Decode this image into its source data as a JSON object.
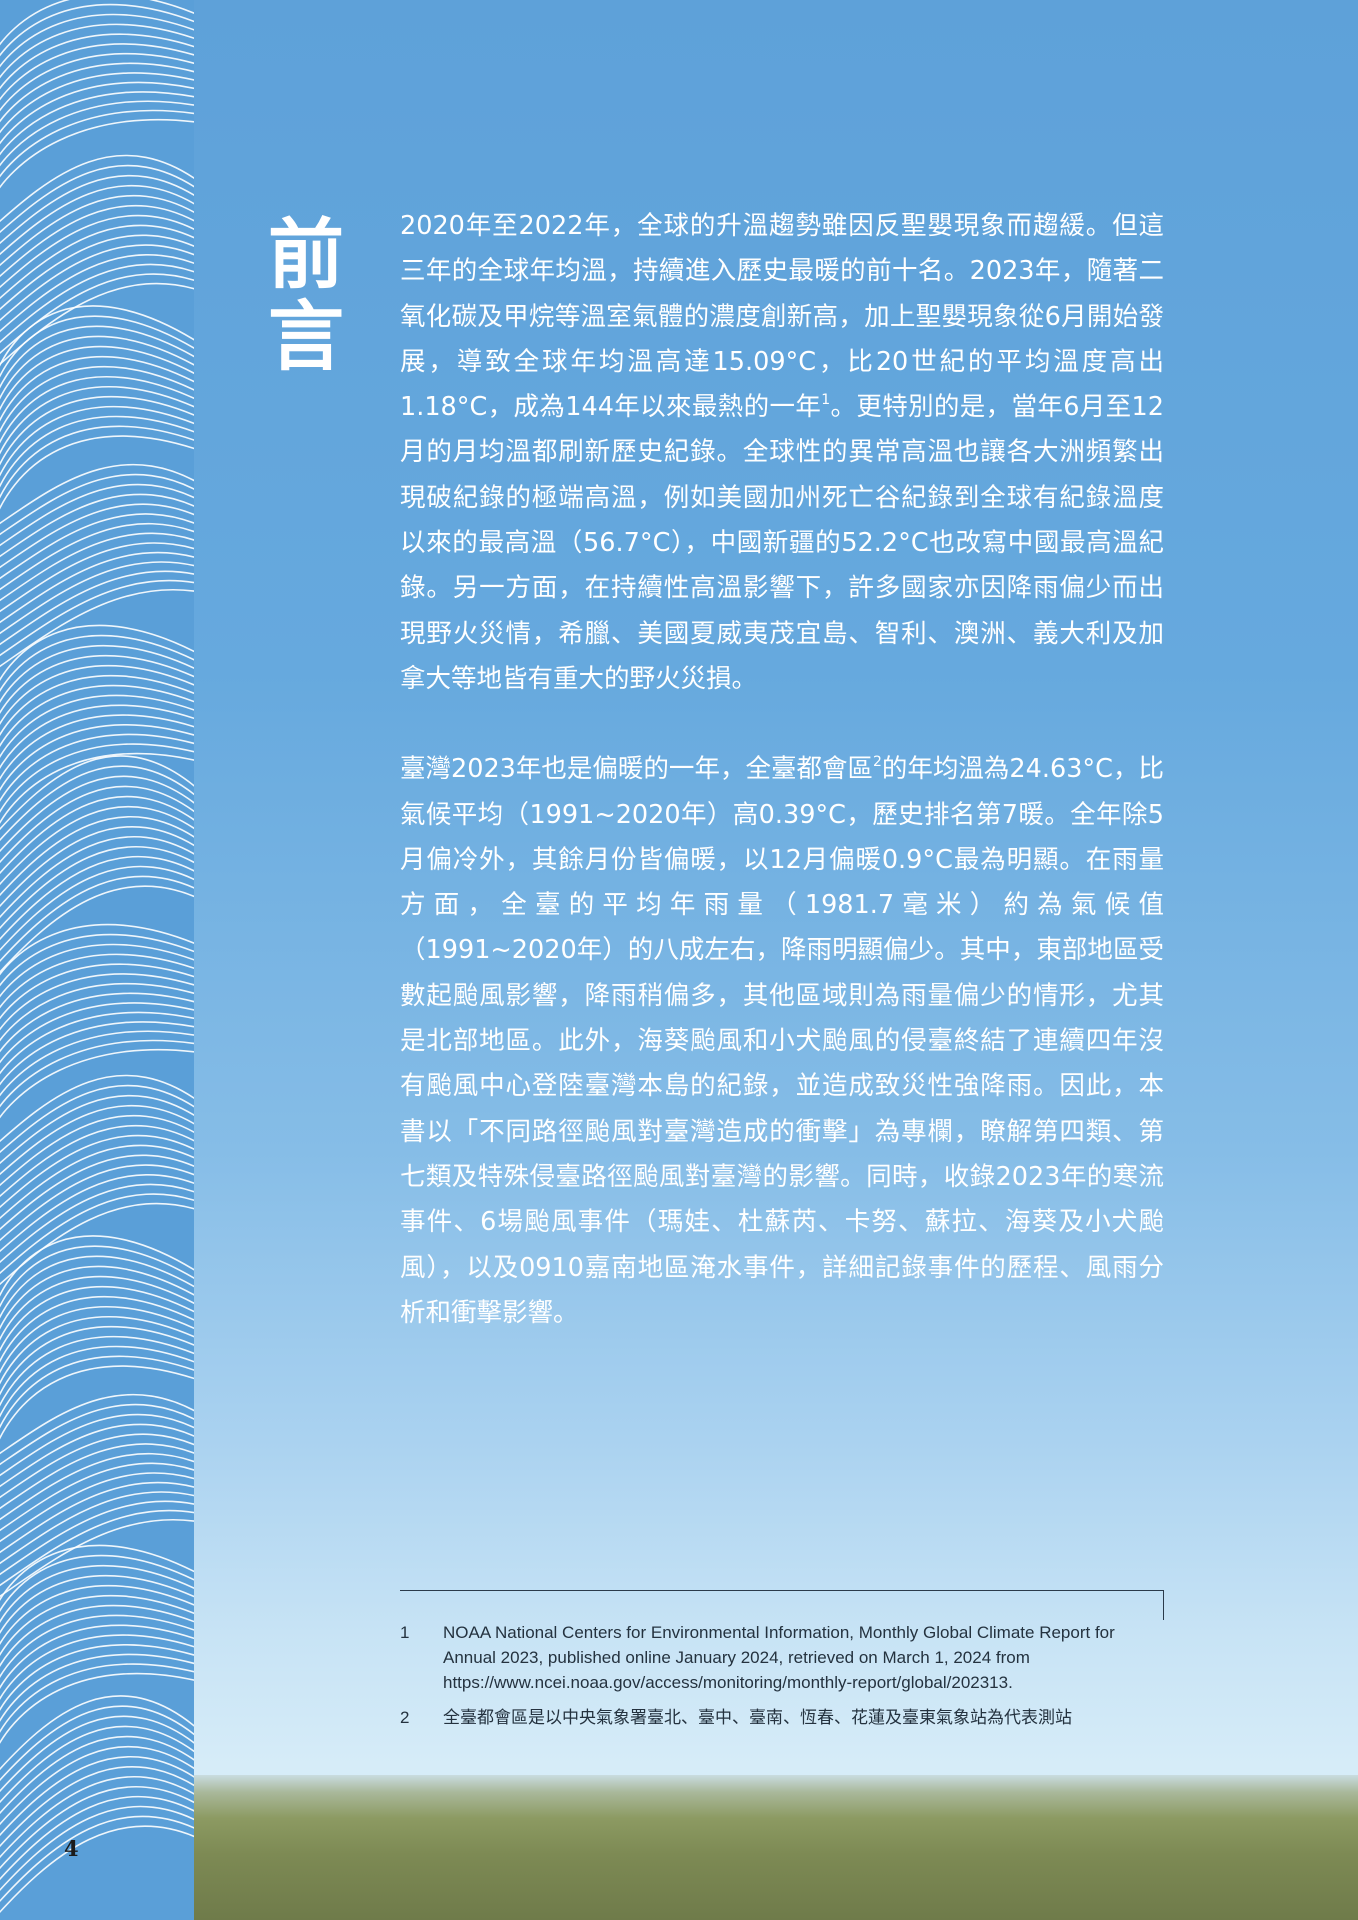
{
  "title": [
    "前",
    "言"
  ],
  "paragraphs": [
    {
      "before": "2020年至2022年，全球的升溫趨勢雖因反聖嬰現象而趨緩。但這三年的全球年均溫，持續進入歷史最暖的前十名。2023年，隨著二氧化碳及甲烷等溫室氣體的濃度創新高，加上聖嬰現象從6月開始發展，導致全球年均溫高達15.09°C，比20世紀的平均溫度高出1.18°C，成為144年以來最熱的一年",
      "sup": "1",
      "after": "。更特別的是，當年6月至12月的月均溫都刷新歷史紀錄。全球性的異常高溫也讓各大洲頻繁出現破紀錄的極端高溫，例如美國加州死亡谷紀錄到全球有紀錄溫度以來的最高溫（56.7°C），中國新疆的52.2°C也改寫中國最高溫紀錄。另一方面，在持續性高溫影響下，許多國家亦因降雨偏少而出現野火災情，希臘、美國夏威夷茂宜島、智利、澳洲、義大利及加拿大等地皆有重大的野火災損。"
    },
    {
      "before": "臺灣2023年也是偏暖的一年，全臺都會區",
      "sup": "2",
      "after": "的年均溫為24.63°C，比氣候平均（1991~2020年）高0.39°C，歷史排名第7暖。全年除5月偏冷外，其餘月份皆偏暖，以12月偏暖0.9°C最為明顯。在雨量方面，全臺的平均年雨量（1981.7毫米）約為氣候值（1991~2020年）的八成左右，降雨明顯偏少。其中，東部地區受數起颱風影響，降雨稍偏多，其他區域則為雨量偏少的情形，尤其是北部地區。此外，海葵颱風和小犬颱風的侵臺終結了連續四年沒有颱風中心登陸臺灣本島的紀錄，並造成致災性強降雨。因此，本書以「不同路徑颱風對臺灣造成的衝擊」為專欄，瞭解第四類、第七類及特殊侵臺路徑颱風對臺灣的影響。同時，收錄2023年的寒流事件、6場颱風事件（瑪娃、杜蘇芮、卡努、蘇拉、海葵及小犬颱風），以及0910嘉南地區淹水事件，詳細記錄事件的歷程、風雨分析和衝擊影響。"
    }
  ],
  "footnotes": [
    {
      "num": "1",
      "text": "NOAA National Centers for Environmental Information, Monthly Global Climate Report for Annual 2023, published online January 2024, retrieved on March 1, 2024 from https://www.ncei.noaa.gov/access/monitoring/monthly-report/global/202313."
    },
    {
      "num": "2",
      "text": "全臺都會區是以中央氣象署臺北、臺中、臺南、恆春、花蓮及臺東氣象站為代表測站"
    }
  ],
  "page_number": "4",
  "colors": {
    "sky_top": "#5ea1d9",
    "sky_bottom": "#d6ecf8",
    "wave_line": "#ffffff",
    "body_text": "#ffffff",
    "footnote_text": "#24323f"
  }
}
